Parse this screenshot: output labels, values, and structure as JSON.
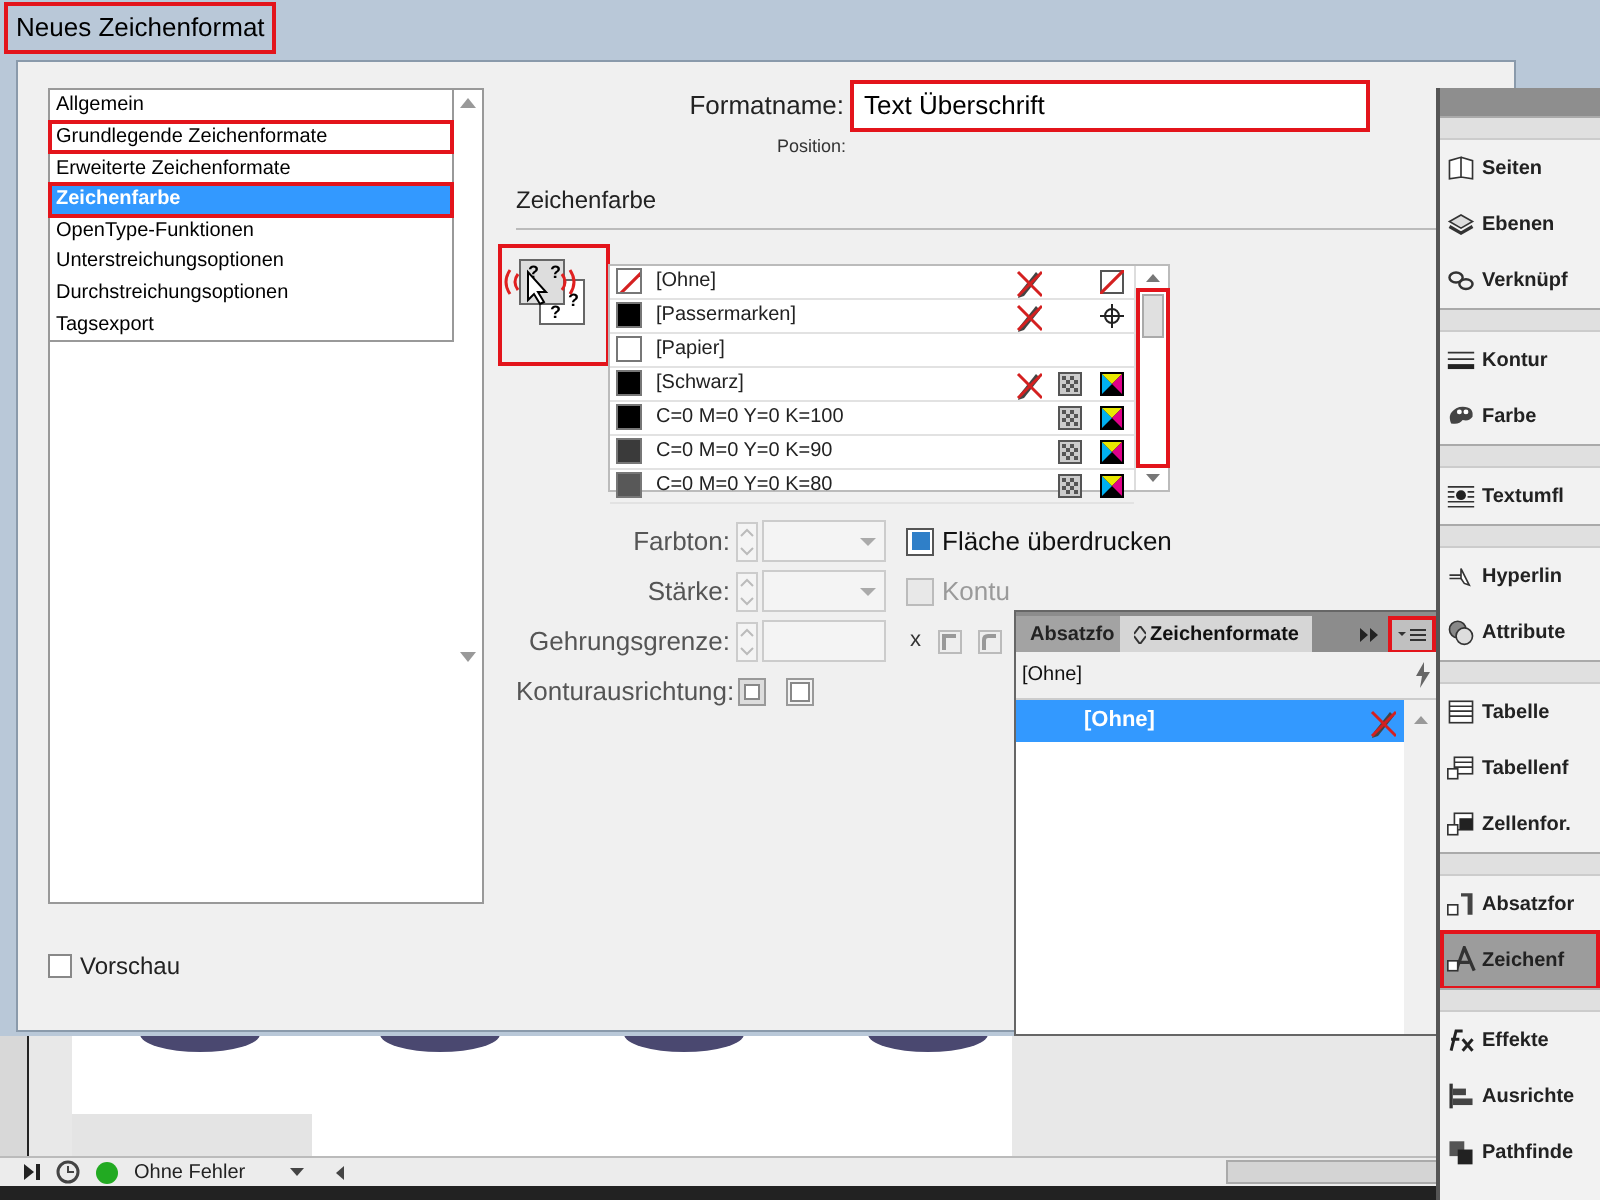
{
  "dialog": {
    "title": "Neues Zeichenformat",
    "title_highlighted": true,
    "categories": [
      {
        "label": "Allgemein",
        "selected": false,
        "highlighted": false
      },
      {
        "label": "Grundlegende Zeichenformate",
        "selected": false,
        "highlighted": true
      },
      {
        "label": "Erweiterte Zeichenformate",
        "selected": false,
        "highlighted": false
      },
      {
        "label": "Zeichenfarbe",
        "selected": true,
        "highlighted": true
      },
      {
        "label": "OpenType-Funktionen",
        "selected": false,
        "highlighted": false
      },
      {
        "label": "Unterstreichungsoptionen",
        "selected": false,
        "highlighted": false
      },
      {
        "label": "Durchstreichungsoptionen",
        "selected": false,
        "highlighted": false
      },
      {
        "label": "Tagsexport",
        "selected": false,
        "highlighted": false
      }
    ],
    "format_name": {
      "label": "Formatname:",
      "value": "Text Überschrift",
      "highlighted": true
    },
    "position_label": "Position:",
    "section_title": "Zeichenfarbe",
    "preview_highlighted": true,
    "scrollbar_highlighted": true,
    "preview_marks": [
      "?",
      "?",
      "?",
      "?"
    ],
    "swatches": [
      {
        "name": "[Ohne]",
        "kind": "none",
        "locked": true
      },
      {
        "name": "[Passermarken]",
        "kind": "registration",
        "color": "#000000",
        "locked": true
      },
      {
        "name": "[Papier]",
        "kind": "paper",
        "color": "#ffffff",
        "locked": false
      },
      {
        "name": "[Schwarz]",
        "kind": "process",
        "color": "#000000",
        "locked": true
      },
      {
        "name": "C=0 M=0 Y=0 K=100",
        "kind": "process",
        "color": "#000000",
        "locked": false
      },
      {
        "name": "C=0 M=0 Y=0 K=90",
        "kind": "process",
        "color": "#3a3a3a",
        "locked": false
      },
      {
        "name": "C=0 M=0 Y=0 K=80",
        "kind": "process",
        "color": "#585858",
        "locked": false
      }
    ],
    "fields": [
      {
        "label": "Farbton:",
        "kind": "spin-dropdown",
        "disabled": true
      },
      {
        "label": "Stärke:",
        "kind": "spin-dropdown",
        "disabled": true
      },
      {
        "label": "Gehrungsgrenze:",
        "kind": "spin-field",
        "disabled": true,
        "suffix": "x"
      },
      {
        "label": "Konturausrichtung:",
        "kind": "align-icons",
        "disabled": true
      }
    ],
    "overprint": [
      {
        "label": "Fläche überdrucken",
        "checked": true,
        "disabled": false
      },
      {
        "label": "Kontu",
        "checked": false,
        "disabled": true
      }
    ],
    "preview": {
      "label": "Vorschau",
      "checked": false
    }
  },
  "styles_panel": {
    "tabs": [
      {
        "label": "Absatzfo",
        "selected": false
      },
      {
        "label": "Zeichenformate",
        "selected": true
      }
    ],
    "menu_highlighted": true,
    "current": "[Ohne]",
    "items": [
      {
        "label": "[Ohne]",
        "selected": true
      }
    ]
  },
  "dock": [
    [
      {
        "label": "Seiten",
        "selected": false,
        "highlighted": false
      },
      {
        "label": "Ebenen",
        "selected": false,
        "highlighted": false
      },
      {
        "label": "Verknüpf",
        "selected": false,
        "highlighted": false
      }
    ],
    [
      {
        "label": "Kontur",
        "selected": false,
        "highlighted": false
      },
      {
        "label": "Farbe",
        "selected": false,
        "highlighted": false
      }
    ],
    [
      {
        "label": "Textumfl",
        "selected": false,
        "highlighted": false
      }
    ],
    [
      {
        "label": "Hyperlin",
        "selected": false,
        "highlighted": false
      },
      {
        "label": "Attribute",
        "selected": false,
        "highlighted": false
      }
    ],
    [
      {
        "label": "Tabelle",
        "selected": false,
        "highlighted": false
      },
      {
        "label": "Tabellenf",
        "selected": false,
        "highlighted": false
      },
      {
        "label": "Zellenfor.",
        "selected": false,
        "highlighted": false
      }
    ],
    [
      {
        "label": "Absatzfor",
        "selected": false,
        "highlighted": false
      },
      {
        "label": "Zeichenf",
        "selected": true,
        "highlighted": true
      }
    ],
    [
      {
        "label": "Effekte",
        "selected": false,
        "highlighted": false
      },
      {
        "label": "Ausrichte",
        "selected": false,
        "highlighted": false
      },
      {
        "label": "Pathfinde",
        "selected": false,
        "highlighted": false
      }
    ]
  ],
  "status_bar": {
    "preflight": "Ohne Fehler",
    "color": "#22aa22"
  }
}
